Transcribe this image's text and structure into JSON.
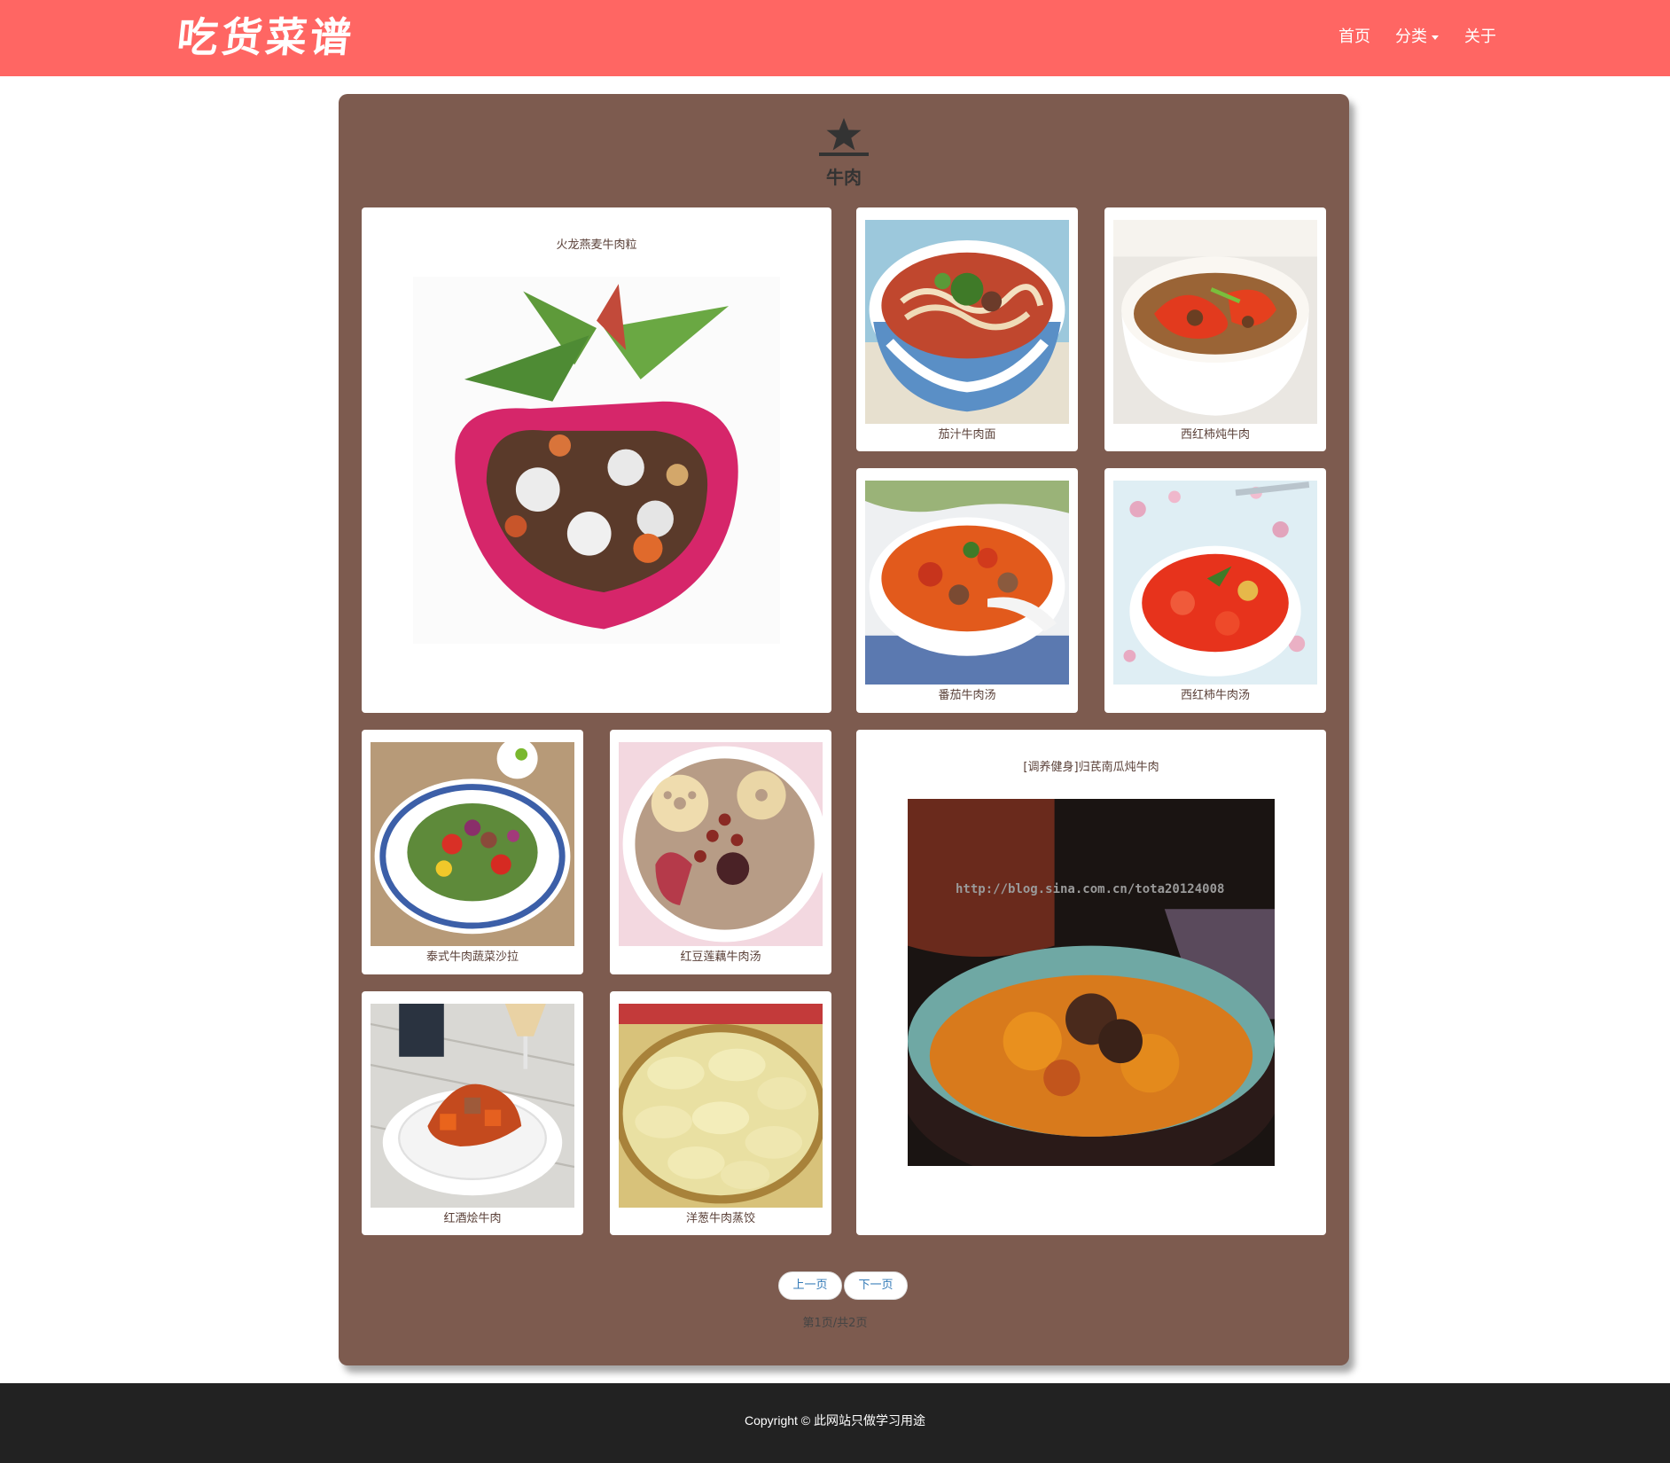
{
  "navbar": {
    "brand": "吃货菜谱",
    "links": {
      "home": "首页",
      "category": "分类",
      "about": "关于"
    },
    "color": "#ff6663"
  },
  "category": {
    "title": "牛肉",
    "icon": "star-icon"
  },
  "recipes": [
    {
      "title": "火龙燕麦牛肉粒",
      "image": "dragon-fruit-beef-photo"
    },
    {
      "title": "茄汁牛肉面",
      "image": "tomato-beef-noodle-photo"
    },
    {
      "title": "西红柿炖牛肉",
      "image": "tomato-stewed-beef-photo"
    },
    {
      "title": "番茄牛肉汤",
      "image": "tomato-beef-soup-photo"
    },
    {
      "title": "西红柿牛肉汤",
      "image": "tomato-beef-broth-photo"
    },
    {
      "title": "泰式牛肉蔬菜沙拉",
      "image": "thai-beef-salad-photo"
    },
    {
      "title": "红豆莲藕牛肉汤",
      "image": "lotus-root-beef-soup-photo"
    },
    {
      "title": "[调养健身]归芪南瓜炖牛肉",
      "image": "pumpkin-stewed-beef-photo",
      "watermark": "http://blog.sina.com.cn/tota20124008"
    },
    {
      "title": "红酒烩牛肉",
      "image": "red-wine-beef-photo"
    },
    {
      "title": "洋葱牛肉蒸饺",
      "image": "onion-beef-dumplings-photo"
    }
  ],
  "pagination": {
    "prev": "上一页",
    "next": "下一页",
    "info": "第1页/共2页",
    "current_page": 1,
    "total_pages": 2
  },
  "footer": {
    "copyright": "Copyright © 此网站只做学习用途"
  },
  "colors": {
    "panel": "#7d5b4f",
    "footer": "#222222",
    "link": "#337ab7"
  }
}
